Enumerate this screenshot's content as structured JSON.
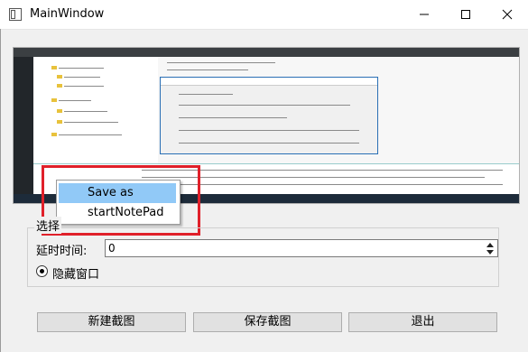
{
  "window": {
    "title": "MainWindow"
  },
  "context_menu": {
    "items": [
      {
        "label": "Save as"
      },
      {
        "label": "startNotePad"
      }
    ]
  },
  "group": {
    "title": "选择",
    "delay_label": "延时时间:",
    "delay_value": "0",
    "hide_window_label": "隐藏窗口"
  },
  "buttons": {
    "new": "新建截图",
    "save": "保存截图",
    "exit": "退出"
  },
  "colors": {
    "highlight": "#91c9f7",
    "red_box": "#e0202a"
  },
  "icons": [
    "app-icon",
    "minimize-icon",
    "maximize-icon",
    "close-icon",
    "spin-up-icon",
    "spin-down-icon"
  ]
}
